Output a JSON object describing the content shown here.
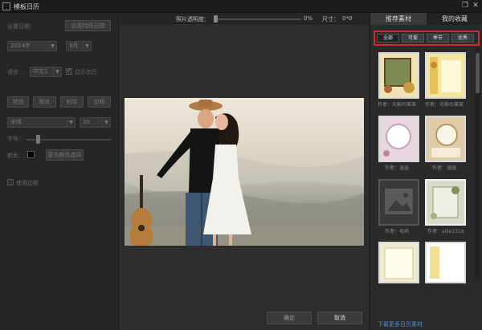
{
  "window": {
    "title": "模板日历",
    "restore_glyph": "❐",
    "close_glyph": "✕"
  },
  "left_panel": {
    "date_label": "设置日期：",
    "set_date_button": "设置特殊日期",
    "year_value": "2014年",
    "month_value": "9月",
    "language_label": "语言：",
    "language_value": "中文1",
    "show_lunar_label": "显示农历",
    "show_lunar_checked": true,
    "style_buttons": [
      "常规",
      "粗体",
      "斜体",
      "加粗"
    ],
    "font_value": "宋体",
    "size_value": "20",
    "font_size_label": "字号：",
    "color_label": "颜色：",
    "color_swatch": "#000000",
    "more_colors_button": "更多颜色选择",
    "border_checkbox_label": "使用边框",
    "border_checked": false
  },
  "top_bar": {
    "opacity_label": "照片透明度：",
    "opacity_value": "0%",
    "opacity_fraction": 0.0,
    "size_label": "尺寸：",
    "size_value": "0*0"
  },
  "actions": {
    "confirm": "确定",
    "cancel": "取消"
  },
  "right_panel": {
    "tabs": [
      "推荐素材",
      "我的收藏"
    ],
    "active_tab": 0,
    "filters": [
      "全部",
      "可爱",
      "季节",
      "优秀"
    ],
    "thumbnails": [
      {
        "author": "作者：光影の某某"
      },
      {
        "author": "作者：光影の某某"
      },
      {
        "author": "作者：涵涵"
      },
      {
        "author": "作者：涵涵"
      },
      {
        "author": "作者：毛妈"
      },
      {
        "author": "作者：ailie1316"
      }
    ],
    "download_link": "下载更多日历素材"
  },
  "colors": {
    "accent_red": "#d12a2a",
    "link_blue": "#4e8fd8",
    "panel_bg": "#2b2b2b"
  }
}
